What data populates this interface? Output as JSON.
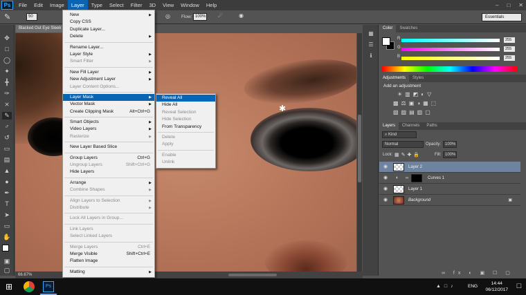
{
  "menubar": {
    "logo": "Ps",
    "items": [
      "File",
      "Edit",
      "Image",
      "Layer",
      "Type",
      "Select",
      "Filter",
      "3D",
      "View",
      "Window",
      "Help"
    ],
    "active": "Layer"
  },
  "options": {
    "brush_size": "50",
    "flow_label": "Flow:",
    "flow_value": "100%",
    "workspace": "Essentials"
  },
  "document": {
    "tab_title": "Blacked Out Eye Sleek",
    "zoom": "66.67%"
  },
  "layer_menu": {
    "items": [
      {
        "label": "New",
        "shortcut": "",
        "submenu": true,
        "disabled": false
      },
      {
        "label": "Copy CSS",
        "shortcut": "",
        "submenu": false,
        "disabled": false
      },
      {
        "label": "Duplicate Layer...",
        "shortcut": "",
        "submenu": false,
        "disabled": false
      },
      {
        "label": "Delete",
        "shortcut": "",
        "submenu": true,
        "disabled": false
      },
      {
        "sep": true
      },
      {
        "label": "Rename Layer...",
        "shortcut": "",
        "submenu": false,
        "disabled": false
      },
      {
        "label": "Layer Style",
        "shortcut": "",
        "submenu": true,
        "disabled": false
      },
      {
        "label": "Smart Filter",
        "shortcut": "",
        "submenu": true,
        "disabled": true
      },
      {
        "sep": true
      },
      {
        "label": "New Fill Layer",
        "shortcut": "",
        "submenu": true,
        "disabled": false
      },
      {
        "label": "New Adjustment Layer",
        "shortcut": "",
        "submenu": true,
        "disabled": false
      },
      {
        "label": "Layer Content Options...",
        "shortcut": "",
        "submenu": false,
        "disabled": true
      },
      {
        "sep": true
      },
      {
        "label": "Layer Mask",
        "shortcut": "",
        "submenu": true,
        "disabled": false,
        "highlight": true
      },
      {
        "label": "Vector Mask",
        "shortcut": "",
        "submenu": true,
        "disabled": false
      },
      {
        "label": "Create Clipping Mask",
        "shortcut": "Alt+Ctrl+G",
        "submenu": false,
        "disabled": false
      },
      {
        "sep": true
      },
      {
        "label": "Smart Objects",
        "shortcut": "",
        "submenu": true,
        "disabled": false
      },
      {
        "label": "Video Layers",
        "shortcut": "",
        "submenu": true,
        "disabled": false
      },
      {
        "label": "Rasterize",
        "shortcut": "",
        "submenu": true,
        "disabled": true
      },
      {
        "sep": true
      },
      {
        "label": "New Layer Based Slice",
        "shortcut": "",
        "submenu": false,
        "disabled": false
      },
      {
        "sep": true
      },
      {
        "label": "Group Layers",
        "shortcut": "Ctrl+G",
        "submenu": false,
        "disabled": false
      },
      {
        "label": "Ungroup Layers",
        "shortcut": "Shift+Ctrl+G",
        "submenu": false,
        "disabled": true
      },
      {
        "label": "Hide Layers",
        "shortcut": "",
        "submenu": false,
        "disabled": false
      },
      {
        "sep": true
      },
      {
        "label": "Arrange",
        "shortcut": "",
        "submenu": true,
        "disabled": false
      },
      {
        "label": "Combine Shapes",
        "shortcut": "",
        "submenu": true,
        "disabled": true
      },
      {
        "sep": true
      },
      {
        "label": "Align Layers to Selection",
        "shortcut": "",
        "submenu": true,
        "disabled": true
      },
      {
        "label": "Distribute",
        "shortcut": "",
        "submenu": true,
        "disabled": true
      },
      {
        "sep": true
      },
      {
        "label": "Lock All Layers in Group...",
        "shortcut": "",
        "submenu": false,
        "disabled": true
      },
      {
        "sep": true
      },
      {
        "label": "Link Layers",
        "shortcut": "",
        "submenu": false,
        "disabled": true
      },
      {
        "label": "Select Linked Layers",
        "shortcut": "",
        "submenu": false,
        "disabled": true
      },
      {
        "sep": true
      },
      {
        "label": "Merge Layers",
        "shortcut": "Ctrl+E",
        "submenu": false,
        "disabled": true
      },
      {
        "label": "Merge Visible",
        "shortcut": "Shift+Ctrl+E",
        "submenu": false,
        "disabled": false
      },
      {
        "label": "Flatten Image",
        "shortcut": "",
        "submenu": false,
        "disabled": false
      },
      {
        "sep": true
      },
      {
        "label": "Matting",
        "shortcut": "",
        "submenu": true,
        "disabled": false
      }
    ]
  },
  "mask_submenu": {
    "items": [
      {
        "label": "Reveal All",
        "disabled": false,
        "highlight": true
      },
      {
        "label": "Hide All",
        "disabled": false
      },
      {
        "label": "Reveal Selection",
        "disabled": true
      },
      {
        "label": "Hide Selection",
        "disabled": true
      },
      {
        "label": "From Transparency",
        "disabled": false
      },
      {
        "sep": true
      },
      {
        "label": "Delete",
        "disabled": true
      },
      {
        "label": "Apply",
        "disabled": true
      },
      {
        "sep": true
      },
      {
        "label": "Enable",
        "disabled": true
      },
      {
        "label": "Unlink",
        "disabled": true
      }
    ]
  },
  "color_panel": {
    "tabs": [
      "Color",
      "Swatches"
    ],
    "channels": [
      {
        "label": "R",
        "value": "255",
        "gradient": "#00ffff,#ffffff"
      },
      {
        "label": "G",
        "value": "255",
        "gradient": "#ff00ff,#ffffff"
      },
      {
        "label": "B",
        "value": "255",
        "gradient": "#ffff00,#ffffff"
      }
    ]
  },
  "adjustments_panel": {
    "tabs": [
      "Adjustments",
      "Styles"
    ],
    "heading": "Add an adjustment"
  },
  "layers_panel": {
    "tabs": [
      "Layers",
      "Channels",
      "Paths"
    ],
    "kind_label": "Kind",
    "blend_mode": "Normal",
    "opacity_label": "Opacity:",
    "opacity_value": "100%",
    "lock_label": "Lock:",
    "fill_label": "Fill:",
    "fill_value": "100%",
    "layers": [
      {
        "name": "Layer 2",
        "selected": true
      },
      {
        "name": "Curves 1",
        "selected": false
      },
      {
        "name": "Layer 1",
        "selected": false
      },
      {
        "name": "Background",
        "selected": false
      }
    ]
  },
  "taskbar": {
    "language": "ENG",
    "time": "14:44",
    "date": "06/12/2017"
  }
}
